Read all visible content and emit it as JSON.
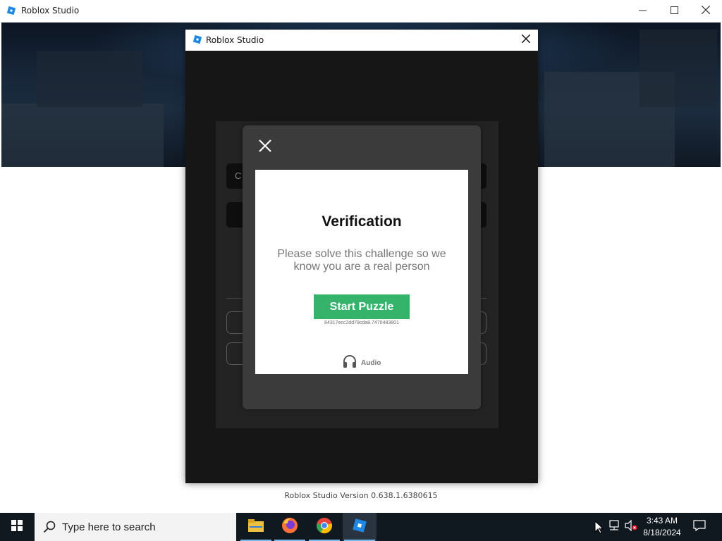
{
  "main_window": {
    "title": "Roblox Studio",
    "icon": "roblox-studio-icon",
    "controls": [
      "minimize",
      "maximize",
      "close"
    ]
  },
  "login_dialog": {
    "title": "Roblox Studio",
    "input_prefix": "C"
  },
  "captcha": {
    "title": "Verification",
    "description": "Please solve this challenge so we know you are a real person",
    "button_label": "Start Puzzle",
    "session_id": "84317ecc2dd79cda8.7470483801",
    "audio_label": "Audio",
    "button_color": "#35b36a"
  },
  "version_text": "Roblox Studio Version 0.638.1.6380615",
  "taskbar": {
    "search_placeholder": "Type here to search",
    "pinned_apps": [
      "file-explorer",
      "firefox",
      "chrome",
      "roblox-studio"
    ],
    "time": "3:43 AM",
    "date": "8/18/2024"
  }
}
